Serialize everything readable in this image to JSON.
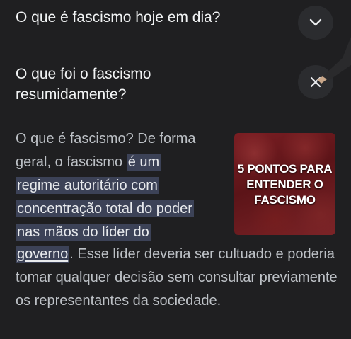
{
  "faq": {
    "question_1": "O que é fascismo hoje em dia?",
    "question_2": "O que foi o fascismo resumidamente?"
  },
  "answer": {
    "intro": "O que é fascismo? De forma geral, o fascismo ",
    "highlight_1": "é um",
    "highlight_2": "regime autoritário com",
    "highlight_3": "concentração total do poder",
    "highlight_4": "nas mãos do líder do",
    "highlight_5": "governo",
    "rest": ". Esse líder deveria ser cultuado e poderia tomar qualquer decisão sem consultar previamente os representantes da sociedade."
  },
  "thumbnail": {
    "line_1": "5 PONTOS PARA",
    "line_2": "ENTENDER O",
    "line_3": "FASCISMO",
    "bg_color": "#6b1a1e"
  },
  "icons": {
    "expand": "chevron-down-icon",
    "collapse": "close-icon"
  }
}
